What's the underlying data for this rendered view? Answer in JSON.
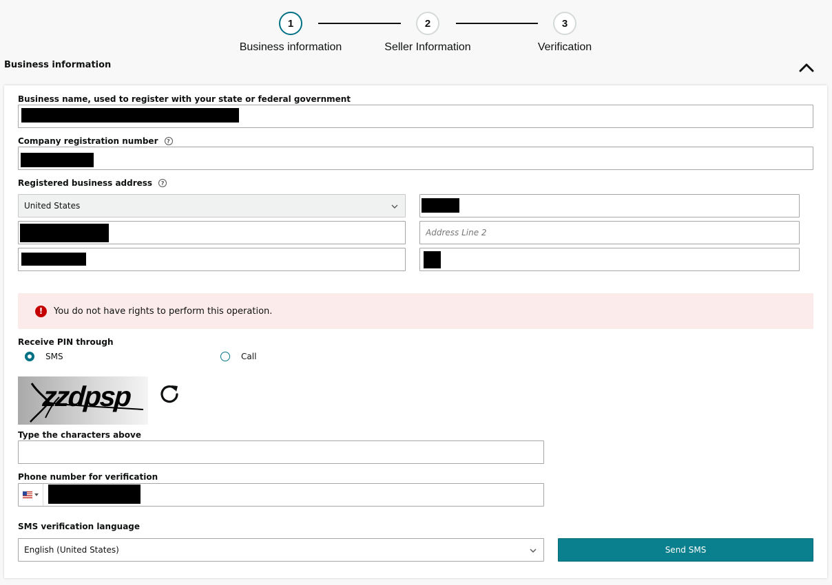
{
  "stepper": {
    "steps": [
      {
        "number": "1",
        "label": "Business information"
      },
      {
        "number": "2",
        "label": "Seller Information"
      },
      {
        "number": "3",
        "label": "Verification"
      }
    ]
  },
  "section": {
    "title": "Business information",
    "collapse_icon": "chevron-up-icon"
  },
  "form": {
    "business_name_label": "Business name, used to register with your state or federal government",
    "registration_number_label": "Company registration number",
    "address_label": "Registered business address",
    "country_value": "United States",
    "address_line2_placeholder": "Address Line 2",
    "help_icon": "question-circle-icon"
  },
  "alert": {
    "icon": "exclamation-circle-icon",
    "message": "You do not have rights to perform this operation.",
    "color": "#c40000",
    "background": "#fcebeb"
  },
  "pin": {
    "label": "Receive PIN through",
    "options": [
      {
        "label": "SMS",
        "checked": true
      },
      {
        "label": "Call",
        "checked": false
      }
    ]
  },
  "captcha": {
    "text": "zzdpsp",
    "refresh_icon": "refresh-icon",
    "input_label": "Type the characters above"
  },
  "phone": {
    "label": "Phone number for verification",
    "flag_icon": "us-flag-icon"
  },
  "sms_language": {
    "label": "SMS verification language",
    "value": "English (United States)"
  },
  "actions": {
    "send_sms_label": "Send SMS",
    "accent": "#0a7f8e"
  }
}
